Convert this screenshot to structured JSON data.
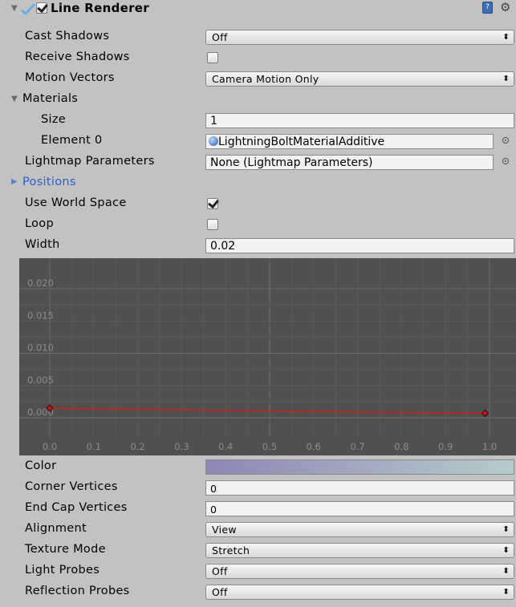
{
  "header": {
    "title": "Line Renderer",
    "enabled": true
  },
  "fields": {
    "cast_shadows": {
      "label": "Cast Shadows",
      "value": "Off"
    },
    "receive_shadows": {
      "label": "Receive Shadows",
      "checked": false
    },
    "motion_vectors": {
      "label": "Motion Vectors",
      "value": "Camera Motion Only"
    },
    "materials": {
      "label": "Materials",
      "size_label": "Size",
      "size_value": "1",
      "element0_label": "Element 0",
      "element0_value": "LightningBoltMaterialAdditive"
    },
    "lightmap_parameters": {
      "label": "Lightmap Parameters",
      "value": "None (Lightmap Parameters)"
    },
    "positions": {
      "label": "Positions"
    },
    "use_world_space": {
      "label": "Use World Space",
      "checked": true
    },
    "loop": {
      "label": "Loop",
      "checked": false
    },
    "width": {
      "label": "Width",
      "value": "0.02"
    },
    "color": {
      "label": "Color",
      "gradient_start": "#8d86b6",
      "gradient_end": "#b6cccb"
    },
    "corner_vertices": {
      "label": "Corner Vertices",
      "value": "0"
    },
    "end_cap_vertices": {
      "label": "End Cap Vertices",
      "value": "0"
    },
    "alignment": {
      "label": "Alignment",
      "value": "View"
    },
    "texture_mode": {
      "label": "Texture Mode",
      "value": "Stretch"
    },
    "light_probes": {
      "label": "Light Probes",
      "value": "Off"
    },
    "reflection_probes": {
      "label": "Reflection Probes",
      "value": "Off"
    }
  },
  "chart_data": {
    "type": "line",
    "x_ticks": [
      "0.0",
      "0.1",
      "0.2",
      "0.3",
      "0.4",
      "0.5",
      "0.6",
      "0.7",
      "0.8",
      "0.9",
      "1.0"
    ],
    "y_ticks": [
      "0.020",
      "0.015",
      "0.010",
      "0.005",
      "0.000"
    ],
    "xlim": [
      0,
      1
    ],
    "ylim": [
      0,
      0.02
    ],
    "series": [
      {
        "x": [
          0.0,
          0.2,
          0.45,
          0.7,
          0.99
        ],
        "y": [
          0.0015,
          0.0013,
          0.0011,
          0.0009,
          0.0007
        ],
        "color": "#d02020"
      }
    ],
    "keys": [
      {
        "x": 0.0,
        "y": 0.0015
      },
      {
        "x": 0.99,
        "y": 0.0007
      }
    ],
    "grid": true
  }
}
